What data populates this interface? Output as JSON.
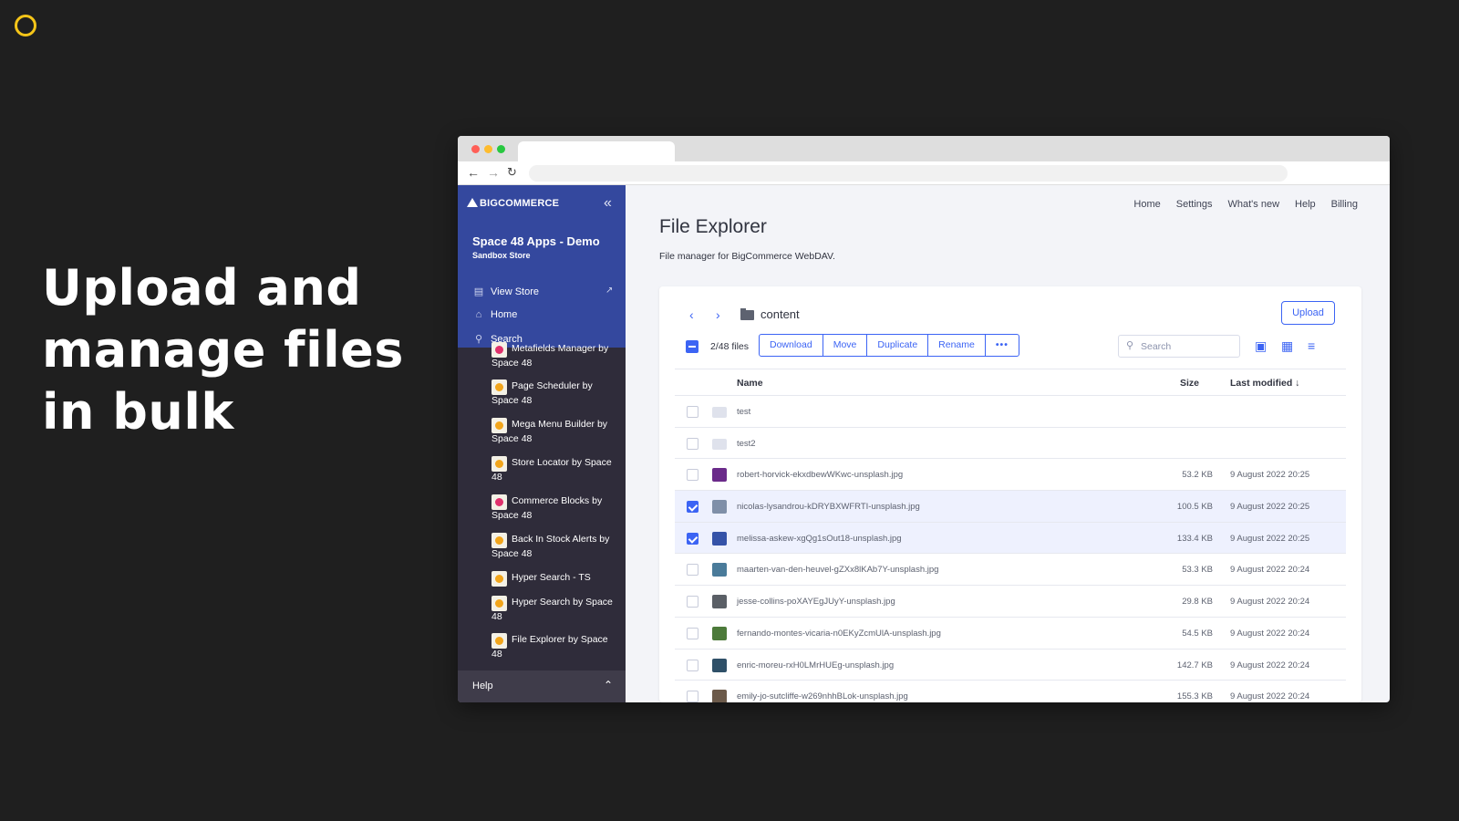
{
  "headline": "Upload and manage files in bulk",
  "sidebar": {
    "logo": "BIGCOMMERCE",
    "store_name": "Space 48 Apps - Demo",
    "store_sub": "Sandbox Store",
    "links": [
      {
        "label": "View Store",
        "icon": "storefront-icon"
      },
      {
        "label": "Home",
        "icon": "home-icon"
      },
      {
        "label": "Search",
        "icon": "search-icon"
      }
    ],
    "apps": [
      {
        "label": "Metafields Manager by Space 48"
      },
      {
        "label": "Page Scheduler by Space 48"
      },
      {
        "label": "Mega Menu Builder by Space 48"
      },
      {
        "label": "Store Locator by Space 48"
      },
      {
        "label": "Commerce Blocks by Space 48"
      },
      {
        "label": "Back In Stock Alerts by Space 48"
      },
      {
        "label": "Hyper Search - TS"
      },
      {
        "label": "Hyper Search by Space 48"
      },
      {
        "label": "File Explorer by Space 48"
      }
    ],
    "help": "Help"
  },
  "topnav": [
    "Home",
    "Settings",
    "What's new",
    "Help",
    "Billing"
  ],
  "page": {
    "title": "File Explorer",
    "subtitle": "File manager for BigCommerce WebDAV."
  },
  "explorer": {
    "folder": "content",
    "upload": "Upload",
    "files_count": "2/48 files",
    "actions": [
      "Download",
      "Move",
      "Duplicate",
      "Rename",
      "•••"
    ],
    "search_placeholder": "Search",
    "columns": {
      "name": "Name",
      "size": "Size",
      "modified": "Last modified ↓"
    },
    "rows": [
      {
        "name": "test",
        "size": "",
        "date": "",
        "type": "folder",
        "checked": false
      },
      {
        "name": "test2",
        "size": "",
        "date": "",
        "type": "folder",
        "checked": false
      },
      {
        "name": "robert-horvick-ekxdbewWKwc-unsplash.jpg",
        "size": "53.2 KB",
        "date": "9 August 2022 20:25",
        "type": "image",
        "thumb_color": "#6a2a8a",
        "checked": false
      },
      {
        "name": "nicolas-lysandrou-kDRYBXWFRTI-unsplash.jpg",
        "size": "100.5 KB",
        "date": "9 August 2022 20:25",
        "type": "image",
        "thumb_color": "#7f8fa8",
        "checked": true
      },
      {
        "name": "melissa-askew-xgQg1sOut18-unsplash.jpg",
        "size": "133.4 KB",
        "date": "9 August 2022 20:25",
        "type": "image",
        "thumb_color": "#3553a8",
        "checked": true
      },
      {
        "name": "maarten-van-den-heuvel-gZXx8lKAb7Y-unsplash.jpg",
        "size": "53.3 KB",
        "date": "9 August 2022 20:24",
        "type": "image",
        "thumb_color": "#4a7b9a",
        "checked": false
      },
      {
        "name": "jesse-collins-poXAYEgJUyY-unsplash.jpg",
        "size": "29.8 KB",
        "date": "9 August 2022 20:24",
        "type": "image",
        "thumb_color": "#5a5f66",
        "checked": false
      },
      {
        "name": "fernando-montes-vicaria-n0EKyZcmUlA-unsplash.jpg",
        "size": "54.5 KB",
        "date": "9 August 2022 20:24",
        "type": "image",
        "thumb_color": "#4c7a3a",
        "checked": false
      },
      {
        "name": "enric-moreu-rxH0LMrHUEg-unsplash.jpg",
        "size": "142.7 KB",
        "date": "9 August 2022 20:24",
        "type": "image",
        "thumb_color": "#2f5068",
        "checked": false
      },
      {
        "name": "emily-jo-sutcliffe-w269nhhBLok-unsplash.jpg",
        "size": "155.3 KB",
        "date": "9 August 2022 20:24",
        "type": "image",
        "thumb_color": "#6c5a4a",
        "checked": false
      }
    ]
  },
  "colors": {
    "accent": "#3c64f4",
    "sidebar_top": "#34489e",
    "sidebar": "#2f2c3a",
    "brand_ring": "#f5c518"
  }
}
